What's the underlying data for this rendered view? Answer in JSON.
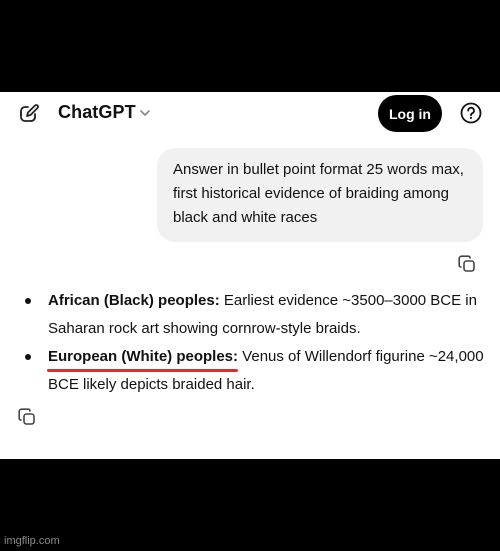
{
  "header": {
    "title": "ChatGPT",
    "login_label": "Log in"
  },
  "user_message": {
    "text": "Answer in bullet point format 25 words max, first historical evidence of braiding among black and white races"
  },
  "answer": {
    "bullets": [
      {
        "bold": "African (Black) peoples:",
        "text": " Earliest evidence ~3500–3000 BCE in Saharan rock art showing cornrow-style braids."
      },
      {
        "bold": "European (White) peoples:",
        "text": " Venus of Willendorf figurine ~24,000 BCE likely depicts braided hair."
      }
    ]
  },
  "icons": {
    "new_chat": "edit-icon",
    "model_menu": "chevron-down-icon",
    "help": "help-circle-icon",
    "copy": "copy-icon"
  },
  "annotation": {
    "underline_color": "#d2352a"
  },
  "watermark": "imgflip.com"
}
